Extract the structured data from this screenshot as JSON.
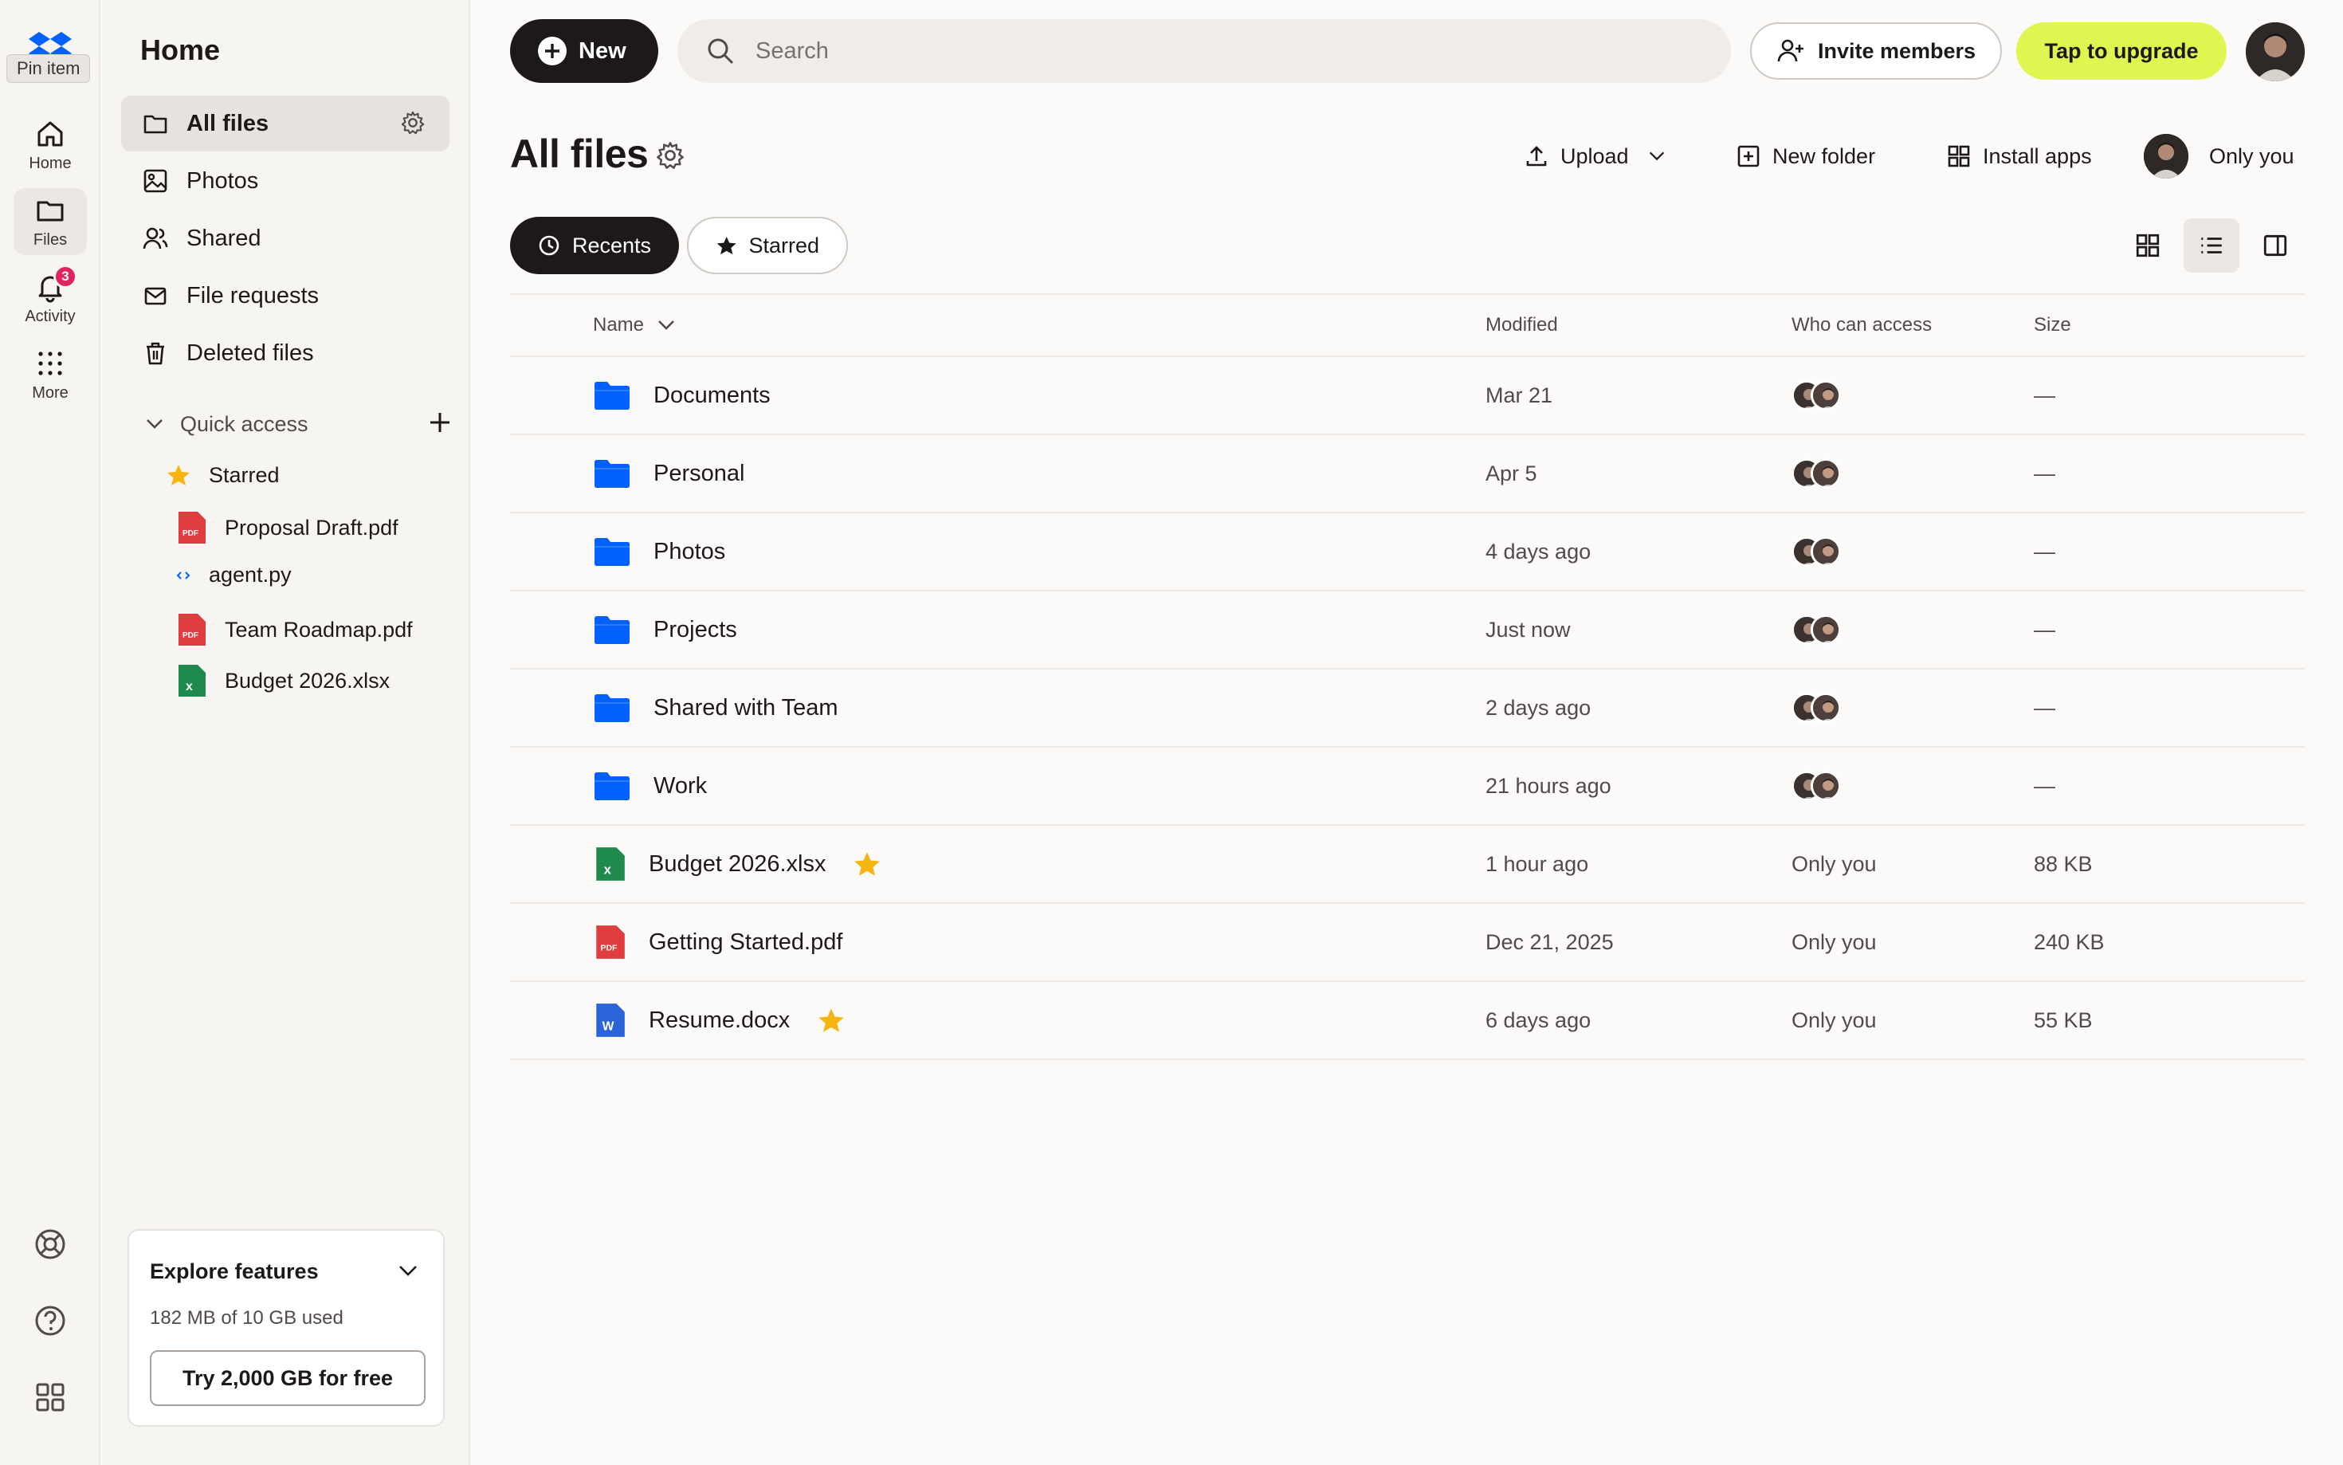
{
  "rail": {
    "pin_tooltip": "Pin item",
    "items": [
      {
        "label": "Home",
        "icon": "home-icon"
      },
      {
        "label": "Files",
        "icon": "folder-icon"
      },
      {
        "label": "Activity",
        "icon": "bell-icon",
        "badge": "3"
      },
      {
        "label": "More",
        "icon": "grid-dots-icon"
      }
    ],
    "bottom_icons": [
      "support-icon",
      "help-icon",
      "apps-icon"
    ]
  },
  "sidebar": {
    "title": "Home",
    "items": [
      {
        "label": "All files",
        "icon": "folder-icon",
        "active": true
      },
      {
        "label": "Photos",
        "icon": "image-icon"
      },
      {
        "label": "Shared",
        "icon": "shared-icon"
      },
      {
        "label": "File requests",
        "icon": "file-request-icon"
      },
      {
        "label": "Deleted files",
        "icon": "trash-icon"
      }
    ],
    "quick_access": {
      "label": "Quick access",
      "items": [
        {
          "label": "Starred",
          "icon": "star-icon"
        },
        {
          "label": "Proposal Draft.pdf",
          "icon": "pdf-icon"
        },
        {
          "label": "agent.py",
          "icon": "code-file-icon"
        },
        {
          "label": "Team Roadmap.pdf",
          "icon": "pdf-icon"
        },
        {
          "label": "Budget 2026.xlsx",
          "icon": "excel-icon"
        }
      ]
    },
    "explore": {
      "title": "Explore features",
      "usage": "182 MB of 10 GB used",
      "cta": "Try 2,000 GB for free"
    }
  },
  "topbar": {
    "new_label": "New",
    "search_placeholder": "Search",
    "invite_label": "Invite members",
    "upgrade_label": "Tap to upgrade"
  },
  "header": {
    "title": "All files",
    "upload_label": "Upload",
    "new_folder_label": "New folder",
    "install_apps_label": "Install apps",
    "owner_label": "Only you"
  },
  "tabs": {
    "recents": "Recents",
    "starred": "Starred"
  },
  "table": {
    "columns": {
      "name": "Name",
      "modified": "Modified",
      "access": "Who can access",
      "size": "Size"
    },
    "rows": [
      {
        "name": "Documents",
        "type": "folder",
        "modified": "Mar 21",
        "access": "shared",
        "size": "—"
      },
      {
        "name": "Personal",
        "type": "folder",
        "modified": "Apr 5",
        "access": "shared",
        "size": "—"
      },
      {
        "name": "Photos",
        "type": "folder",
        "modified": "4 days ago",
        "access": "shared",
        "size": "—"
      },
      {
        "name": "Projects",
        "type": "folder",
        "modified": "Just now",
        "access": "shared",
        "size": "—"
      },
      {
        "name": "Shared with Team",
        "type": "folder",
        "modified": "2 days ago",
        "access": "shared",
        "size": "—"
      },
      {
        "name": "Work",
        "type": "folder",
        "modified": "21 hours ago",
        "access": "shared",
        "size": "—"
      },
      {
        "name": "Budget 2026.xlsx",
        "type": "xlsx",
        "starred": true,
        "modified": "1 hour ago",
        "access": "Only you",
        "size": "88 KB"
      },
      {
        "name": "Getting Started.pdf",
        "type": "pdf",
        "modified": "Dec 21, 2025",
        "access": "Only you",
        "size": "240 KB"
      },
      {
        "name": "Resume.docx",
        "type": "docx",
        "starred": true,
        "modified": "6 days ago",
        "access": "Only you",
        "size": "55 KB"
      }
    ]
  },
  "colors": {
    "accent": "#0061fe",
    "upgrade": "#dff550",
    "star": "#f5b50e",
    "badge": "#e0245e"
  }
}
